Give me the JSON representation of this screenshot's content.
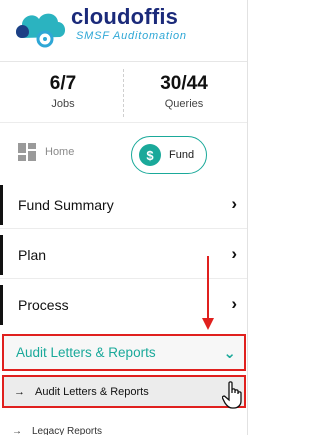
{
  "brand": {
    "name": "cloudoffis",
    "tagline": "SMSF Auditomation"
  },
  "stats": {
    "jobs": {
      "value": "6/7",
      "label": "Jobs"
    },
    "queries": {
      "value": "30/44",
      "label": "Queries"
    }
  },
  "tabs": {
    "home": {
      "label": "Home",
      "icon": "grid-icon"
    },
    "fund": {
      "label": "Fund",
      "icon": "dollar-coin-icon",
      "active": true
    }
  },
  "menu": {
    "sections": [
      {
        "label": "Fund Summary",
        "expanded": false
      },
      {
        "label": "Plan",
        "expanded": false
      },
      {
        "label": "Process",
        "expanded": false
      },
      {
        "label": "Audit Letters & Reports",
        "expanded": true
      }
    ],
    "subitems": [
      {
        "label": "Audit Letters & Reports",
        "active": true
      },
      {
        "label": "Legacy Reports"
      }
    ]
  },
  "colors": {
    "accent": "#1aa99a",
    "highlight": "#e0201e",
    "brand": "#1b2a7a",
    "tagline": "#2ea7d6"
  },
  "glyphs": {
    "arrow": "→",
    "coin": "$"
  }
}
